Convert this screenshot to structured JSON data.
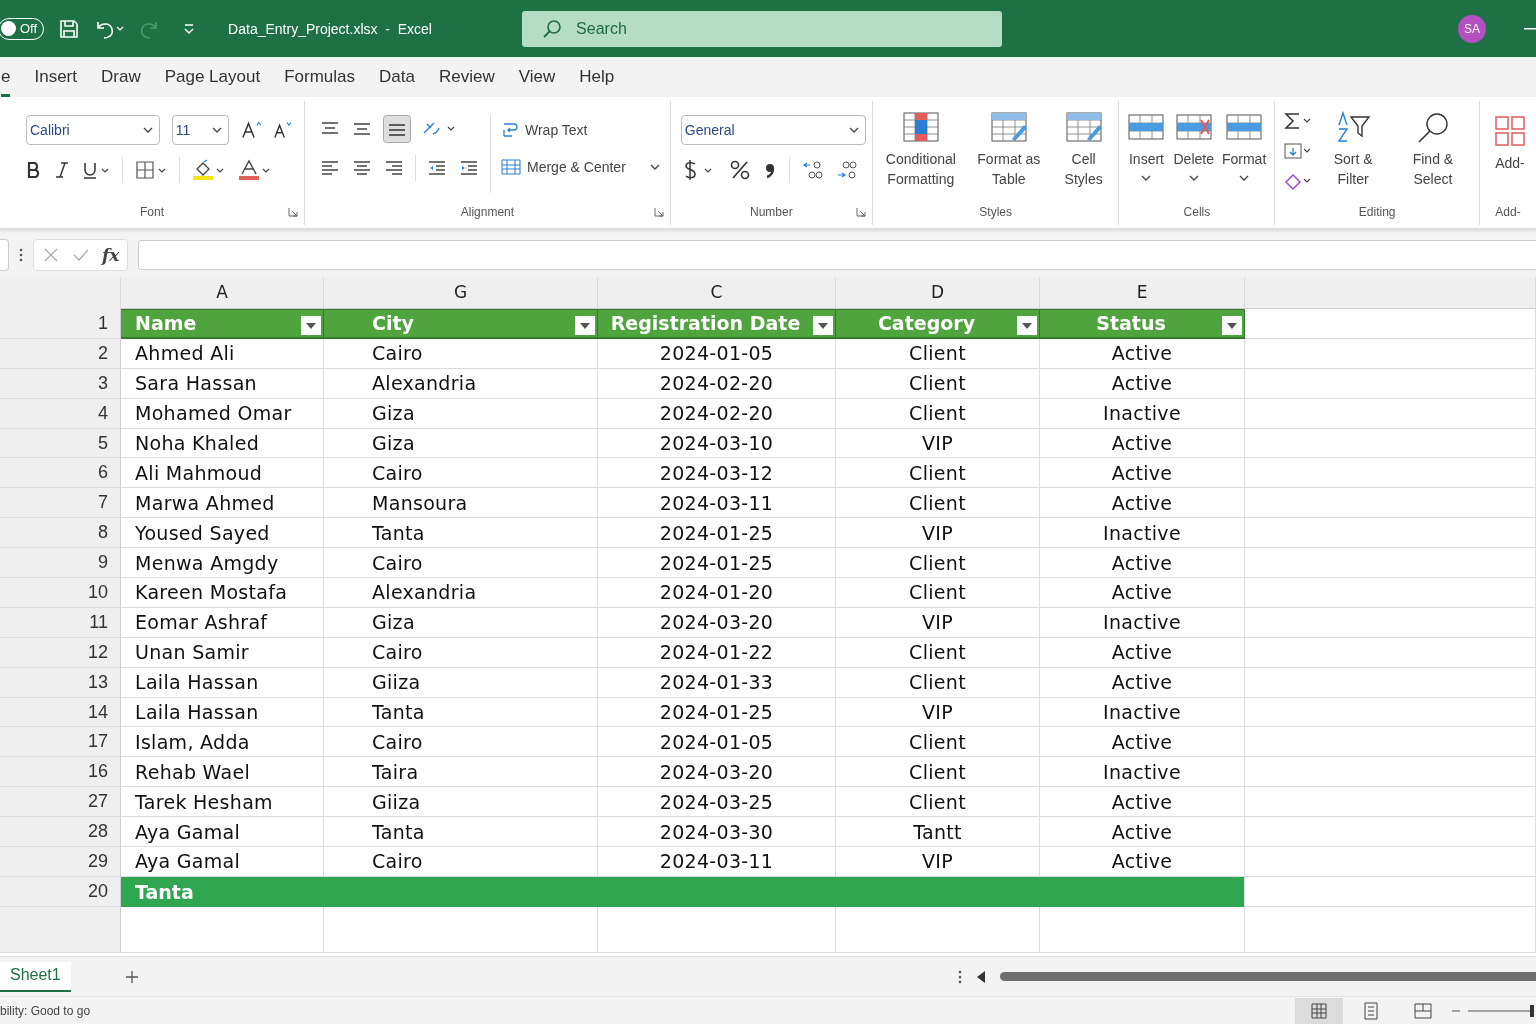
{
  "title_bar": {
    "autosave": {
      "label": "Off",
      "on": false
    },
    "file_title": "Data_Entry_Project.xlsx  -  Excel",
    "search": {
      "placeholder": "Search"
    },
    "avatar": "SA"
  },
  "menu_tabs": [
    {
      "label": "e",
      "selected": true
    },
    {
      "label": "Insert",
      "selected": false
    },
    {
      "label": "Draw",
      "selected": false
    },
    {
      "label": "Page Layout",
      "selected": false
    },
    {
      "label": "Formulas",
      "selected": false
    },
    {
      "label": "Data",
      "selected": false
    },
    {
      "label": "Review",
      "selected": false
    },
    {
      "label": "View",
      "selected": false
    },
    {
      "label": "Help",
      "selected": false
    }
  ],
  "ribbon": {
    "font": {
      "name": "Calibri",
      "size": "11",
      "group_label": "Font"
    },
    "alignment": {
      "wrap_text": "Wrap Text",
      "merge_center": "Merge & Center",
      "group_label": "Alignment"
    },
    "number": {
      "format": "General",
      "group_label": "Number"
    },
    "styles": {
      "buttons": [
        "Conditional Formatting",
        "Format as Table",
        "Cell Styles"
      ],
      "group_label": "Styles"
    },
    "cells": {
      "buttons": [
        "Insert",
        "Delete",
        "Format"
      ],
      "group_label": "Cells"
    },
    "editing": {
      "buttons": [
        "Sort & Filter",
        "Find & Select"
      ],
      "group_label": "Editing"
    },
    "add_ins": {
      "button": "Add-",
      "group_label": "Add-"
    }
  },
  "formula_bar": {
    "function_label": "fx"
  },
  "sheet": {
    "column_letters": [
      "A",
      "G",
      "C",
      "D",
      "E"
    ],
    "header_row_num": "1",
    "headers": [
      "Name",
      "City",
      "Registration Date",
      "Category",
      "Status"
    ],
    "rows": [
      {
        "num": "2",
        "cells": [
          "Ahmed Ali",
          "Cairo",
          "2024-01-05",
          "Client",
          "Active"
        ]
      },
      {
        "num": "3",
        "cells": [
          "Sara Hassan",
          "Alexandria",
          "2024-02-20",
          "Client",
          "Active"
        ]
      },
      {
        "num": "4",
        "cells": [
          "Mohamed Omar",
          "Giza",
          "2024-02-20",
          "Client",
          "Inactive"
        ]
      },
      {
        "num": "5",
        "cells": [
          "Noha Khaled",
          "Giza",
          "2024-03-10",
          "VIP",
          "Active"
        ]
      },
      {
        "num": "6",
        "cells": [
          "Ali Mahmoud",
          "Cairo",
          "2024-03-12",
          "Client",
          "Active"
        ]
      },
      {
        "num": "7",
        "cells": [
          "Marwa Ahmed",
          "Mansoura",
          "2024-03-11",
          "Client",
          "Active"
        ]
      },
      {
        "num": "8",
        "cells": [
          "Yoused Sayed",
          "Tanta",
          "2024-01-25",
          "VIP",
          "Inactive"
        ]
      },
      {
        "num": "9",
        "cells": [
          "Menwa Amgdy",
          "Cairo",
          "2024-01-25",
          "Client",
          "Active"
        ]
      },
      {
        "num": "10",
        "cells": [
          "Kareen Mostafa",
          "Alexandria",
          "2024-01-20",
          "Client",
          "Active"
        ]
      },
      {
        "num": "11",
        "cells": [
          "Eomar Ashraf",
          "Giza",
          "2024-03-20",
          "VIP",
          "Inactive"
        ]
      },
      {
        "num": "12",
        "cells": [
          "Unan Samir",
          "Cairo",
          "2024-01-22",
          "Client",
          "Active"
        ]
      },
      {
        "num": "13",
        "cells": [
          "Laila Hassan",
          "Giiza",
          "2024-01-33",
          "Client",
          "Active"
        ]
      },
      {
        "num": "14",
        "cells": [
          "Laila Hassan",
          "Tanta",
          "2024-01-25",
          "VIP",
          "Inactive"
        ]
      },
      {
        "num": "17",
        "cells": [
          "Islam, Adda",
          "Cairo",
          "2024-01-05",
          "Client",
          "Active"
        ]
      },
      {
        "num": "16",
        "cells": [
          "Rehab Wael",
          "Taira",
          "2024-03-20",
          "Client",
          "Inactive"
        ]
      },
      {
        "num": "27",
        "cells": [
          "Tarek Hesham",
          "Giiza",
          "2024-03-25",
          "Client",
          "Active"
        ]
      },
      {
        "num": "28",
        "cells": [
          "Aya Gamal",
          "Tanta",
          "2024-03-30",
          "Tantt",
          "Active"
        ]
      },
      {
        "num": "29",
        "cells": [
          "Aya Gamal",
          "Cairo",
          "2024-03-11",
          "VIP",
          "Active"
        ]
      }
    ],
    "total_row": {
      "num": "20",
      "label": "Tanta"
    }
  },
  "sheet_tabs": [
    {
      "label": "Sheet1",
      "selected": true
    }
  ],
  "status_bar": {
    "text": "bility: Good to go"
  }
}
